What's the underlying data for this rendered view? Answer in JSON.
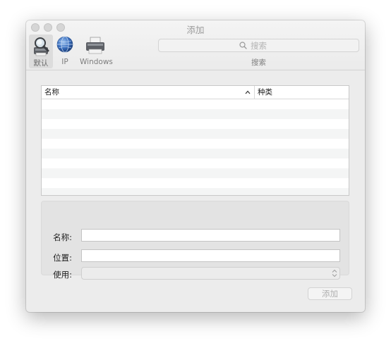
{
  "window": {
    "title": "添加"
  },
  "toolbar": {
    "items": [
      {
        "label": "默认",
        "icon": "magnifier-printer-icon",
        "selected": true
      },
      {
        "label": "IP",
        "icon": "globe-icon",
        "selected": false
      },
      {
        "label": "Windows",
        "icon": "printer-icon",
        "selected": false
      }
    ],
    "search": {
      "placeholder": "搜索",
      "value": "",
      "label": "搜索"
    }
  },
  "table": {
    "columns": [
      {
        "label": "名称",
        "sort": "ascending"
      },
      {
        "label": "种类"
      }
    ],
    "rows": []
  },
  "form": {
    "name_label": "名称:",
    "name_value": "",
    "location_label": "位置:",
    "location_value": "",
    "use_label": "使用:",
    "use_value": ""
  },
  "buttons": {
    "add_label": "添加",
    "add_enabled": false
  },
  "colors": {
    "window_bg": "#ececec",
    "row_alt": "#f4f5f5",
    "disabled_text": "#b0b0b0"
  }
}
